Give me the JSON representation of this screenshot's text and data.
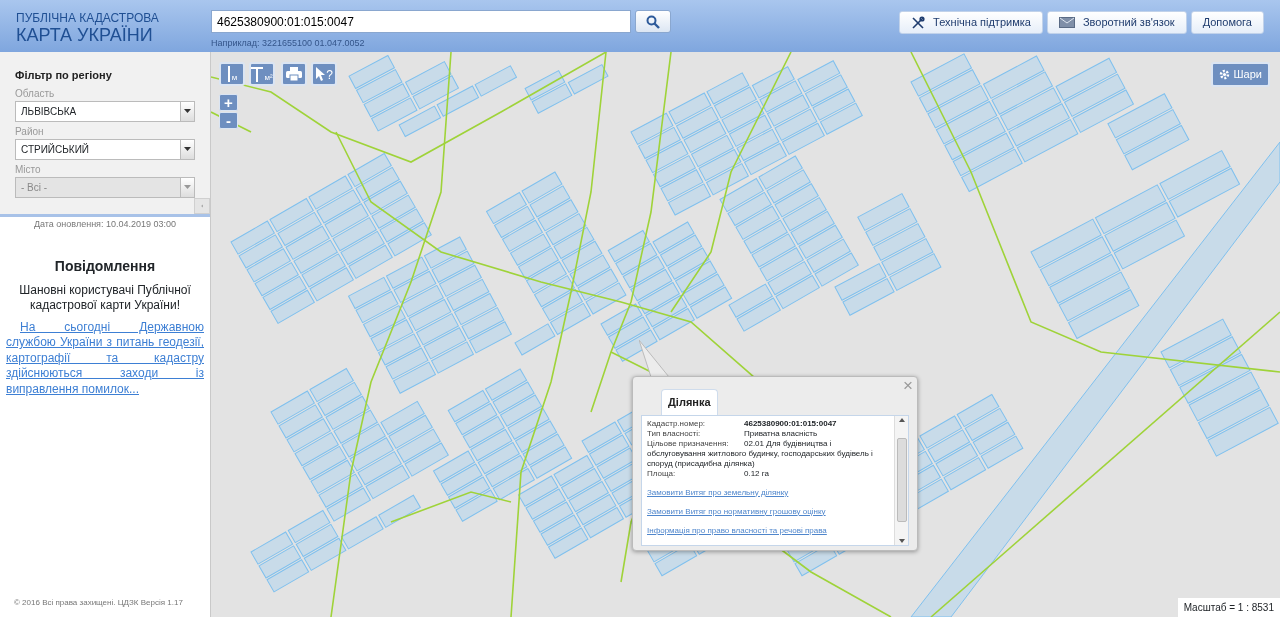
{
  "header": {
    "title_top": "ПУБЛІЧНА КАДАСТРОВА",
    "title_main": "КАРТА УКРАЇНИ"
  },
  "search": {
    "value": "4625380900:01:015:0047",
    "hint": "Наприклад: 3221655100 01.047.0052"
  },
  "nav_buttons": [
    {
      "kind": "support",
      "label": "Технічна підтримка"
    },
    {
      "kind": "mail",
      "label": "Зворотний зв'язок"
    },
    {
      "kind": "plain",
      "label": "Допомога"
    }
  ],
  "filter": {
    "title": "Фільтр по регіону",
    "fields": [
      {
        "label": "Область",
        "value": "ЛЬВІВСЬКА",
        "disabled": false
      },
      {
        "label": "Район",
        "value": "СТРИЙСЬКИЙ",
        "disabled": false
      },
      {
        "label": "Місто",
        "value": "- Всі -",
        "disabled": true
      }
    ]
  },
  "update_date": "Дата оновлення: 10.04.2019 03:00",
  "notice": {
    "title": "Повідомлення",
    "greeting": "Шановні користувачі Публічної кадастрової карти України!",
    "link": "На сьогодні Державною службою України з питань геодезії, картографії та кадастру здійснюються заходи із виправлення помилок..."
  },
  "copyright": "© 2016 Всі права захищені. ЦДЗК Версія 1.17",
  "map_tools": [
    {
      "kind": "distance",
      "unit": "м"
    },
    {
      "kind": "area",
      "unit": "м²"
    },
    {
      "kind": "print"
    },
    {
      "kind": "identify",
      "unit": "?"
    }
  ],
  "zoom": [
    "+",
    "-"
  ],
  "layers_button": "Шари",
  "popup": {
    "close": "×",
    "tabs": [
      {
        "label": "Ділянка",
        "selected": true
      }
    ],
    "rows": [
      {
        "label": "Кадастр.номер:",
        "value": "4625380900:01:015:0047",
        "bold": true
      },
      {
        "label": "Тип власності:",
        "value": "Приватна власність",
        "bold": false
      },
      {
        "label": "Цільове призначення:",
        "value": "02.01 Для будівництва і обслуговування житлового будинку, господарських будівель і споруд (присадибна ділянка)",
        "bold": false
      },
      {
        "label": "Площа:",
        "value": "0.12 га",
        "bold": false
      }
    ],
    "links": [
      "Замовити Витяг про земельну ділянку",
      "Замовити Витяг про нормативну грошову оцінку",
      "Інформація про право власності та речові права"
    ]
  },
  "scale": "Масштаб = 1 : 8531"
}
